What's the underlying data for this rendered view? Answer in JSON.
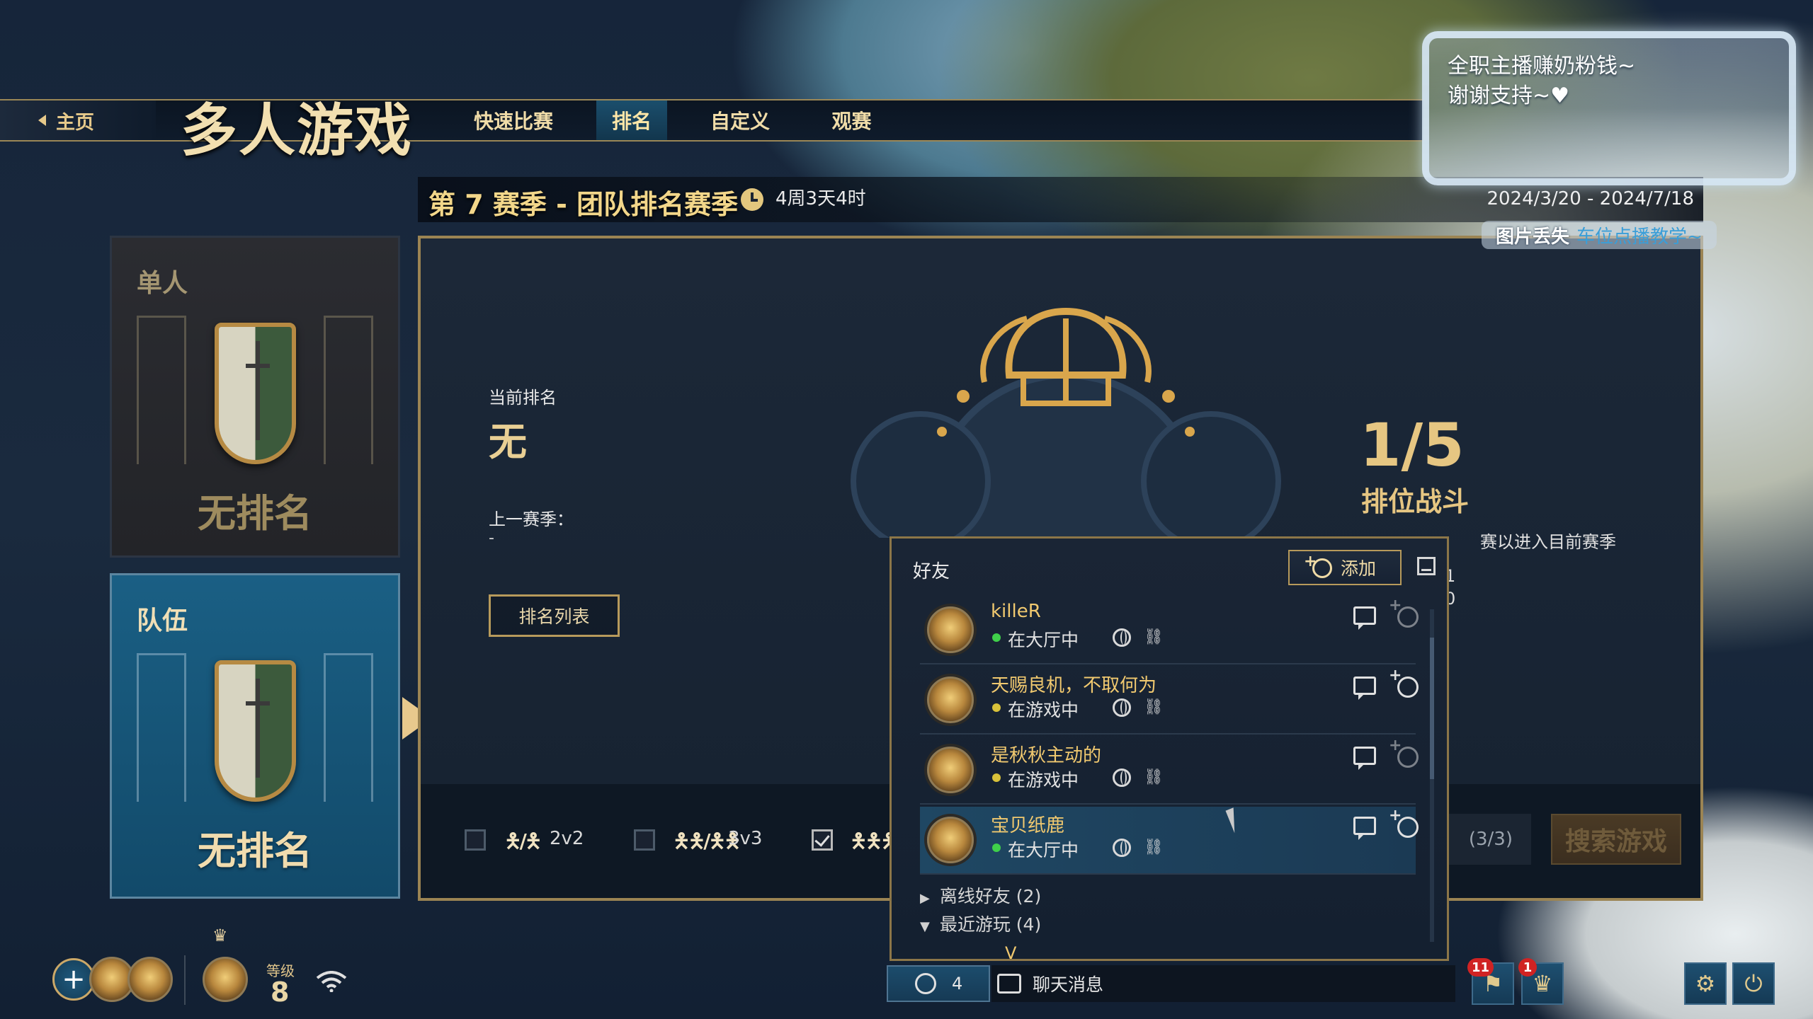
{
  "header": {
    "home_label": "主页",
    "title": "多人游戏",
    "tabs": [
      {
        "label": "快速比赛",
        "active": false
      },
      {
        "label": "排名",
        "active": true
      },
      {
        "label": "自定义",
        "active": false
      },
      {
        "label": "观赛",
        "active": false
      }
    ]
  },
  "season": {
    "title": "第 7 赛季 - 团队排名赛季",
    "remaining": "4周3天4时",
    "dates": "2024/3/20 - 2024/7/18"
  },
  "modes": {
    "solo": {
      "label": "单人",
      "rank": "无排名"
    },
    "team": {
      "label": "队伍",
      "rank": "无排名"
    }
  },
  "ranking": {
    "current_label": "当前排名",
    "current_value": "无",
    "previous_label": "上一赛季：",
    "previous_value": "-",
    "list_button": "排名列表"
  },
  "placement": {
    "value": "1/5",
    "label": "排位战斗",
    "desc_visible": "赛以进入目前赛季",
    "row1_visible": "1",
    "row2_visible": "0"
  },
  "team_sizes": [
    {
      "label": "2v2",
      "glyph": "🯅/🯅",
      "checked": false
    },
    {
      "label": "3v3",
      "glyph": "🯅🯅/🯅🯅",
      "checked": false
    },
    {
      "label": "",
      "glyph": "🯅🯅🯅/",
      "checked": true
    }
  ],
  "search": {
    "mode_count": "(3/3)",
    "button": "搜索游戏"
  },
  "friends": {
    "title": "好友",
    "add_label": "添加",
    "list": [
      {
        "name": "killeR",
        "status": "在大厅中",
        "status_color": "#3fd04a",
        "highlight": false,
        "invite_dim": true
      },
      {
        "name": "天赐良机，不取何为",
        "status": "在游戏中",
        "status_color": "#d9c23a",
        "highlight": false,
        "invite_dim": false
      },
      {
        "name": "是秋秋主动的",
        "status": "在游戏中",
        "status_color": "#d9c23a",
        "highlight": false,
        "invite_dim": true
      },
      {
        "name": "宝贝纸鹿",
        "status": "在大厅中",
        "status_color": "#3fd04a",
        "highlight": true,
        "invite_dim": false
      }
    ],
    "groups": [
      {
        "label": "离线好友 (2)",
        "chevron": "▶"
      },
      {
        "label": "最近游玩 (4)",
        "chevron": "▼"
      }
    ],
    "partial_row_name": "V"
  },
  "bottom": {
    "level_label": "等级",
    "level_value": "8",
    "friends_online": "4",
    "chat_label": "聊天消息",
    "notify_badge_1": "11",
    "notify_badge_2": "1"
  },
  "overlay": {
    "line1": "全职主播赚奶粉钱~",
    "line2": "谢谢支持~♥",
    "sub_a": "图片丢失",
    "sub_b": "车位点播教学~"
  },
  "icons": {
    "home": "chevron-left-icon",
    "clock": "clock-icon",
    "settings": "gear-icon",
    "power": "power-icon",
    "wifi": "wifi-icon",
    "crown": "crown-icon"
  },
  "colors": {
    "gold": "#e6c682",
    "active_tab": "#1b4e6c",
    "online": "#3fd04a",
    "in_game": "#d9c23a",
    "badge": "#d02323"
  }
}
